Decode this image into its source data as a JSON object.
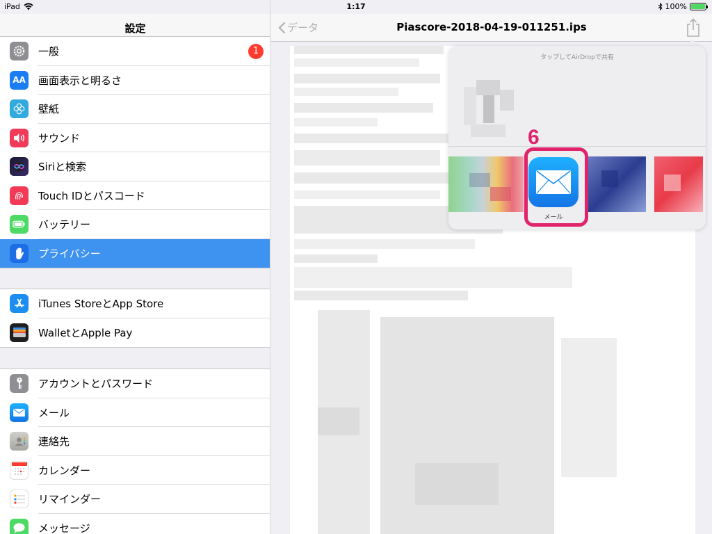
{
  "status_bar": {
    "device": "iPad",
    "time": "1:17",
    "battery": "100%",
    "battery_level": 1.0
  },
  "sidebar": {
    "title": "設定",
    "groups": [
      {
        "items": [
          {
            "label": "一般",
            "icon": "gear-icon",
            "color": "#8e8e93",
            "badge": "1"
          },
          {
            "label": "画面表示と明るさ",
            "icon": "display-brightness-icon",
            "color": "#1c7cf2"
          },
          {
            "label": "壁紙",
            "icon": "wallpaper-flower-icon",
            "color": "#33aadd"
          },
          {
            "label": "サウンド",
            "icon": "speaker-icon",
            "color": "#f03a5a"
          },
          {
            "label": "Siriと検索",
            "icon": "siri-icon",
            "color": "#2b2b4a"
          },
          {
            "label": "Touch IDとパスコード",
            "icon": "fingerprint-icon",
            "color": "#f23a56"
          },
          {
            "label": "バッテリー",
            "icon": "battery-icon",
            "color": "#4cd964"
          },
          {
            "label": "プライバシー",
            "icon": "hand-icon",
            "color": "#1c7cf2",
            "selected": true
          }
        ]
      },
      {
        "items": [
          {
            "label": "iTunes StoreとApp Store",
            "icon": "app-store-icon",
            "color": "#1c8ef0"
          },
          {
            "label": "WalletとApple Pay",
            "icon": "wallet-icon",
            "color": "#1f1f1f"
          }
        ]
      },
      {
        "items": [
          {
            "label": "アカウントとパスワード",
            "icon": "key-icon",
            "color": "#8e8e93"
          },
          {
            "label": "メール",
            "icon": "mail-icon",
            "color": "#1c8ef0"
          },
          {
            "label": "連絡先",
            "icon": "contacts-icon",
            "color": "#b8b8b8"
          },
          {
            "label": "カレンダー",
            "icon": "calendar-icon",
            "color": "#ffffff"
          },
          {
            "label": "リマインダー",
            "icon": "reminders-icon",
            "color": "#ffffff"
          },
          {
            "label": "メッセージ",
            "icon": "messages-icon",
            "color": "#4cd964"
          }
        ]
      }
    ]
  },
  "detail": {
    "back_label": "データ",
    "title": "Piascore-2018-04-19-011251.ips"
  },
  "share_sheet": {
    "airdrop_label": "タップしてAirDropで共有",
    "mail_label": "メール"
  },
  "annotation": {
    "step": "6",
    "color": "#e0246c"
  }
}
